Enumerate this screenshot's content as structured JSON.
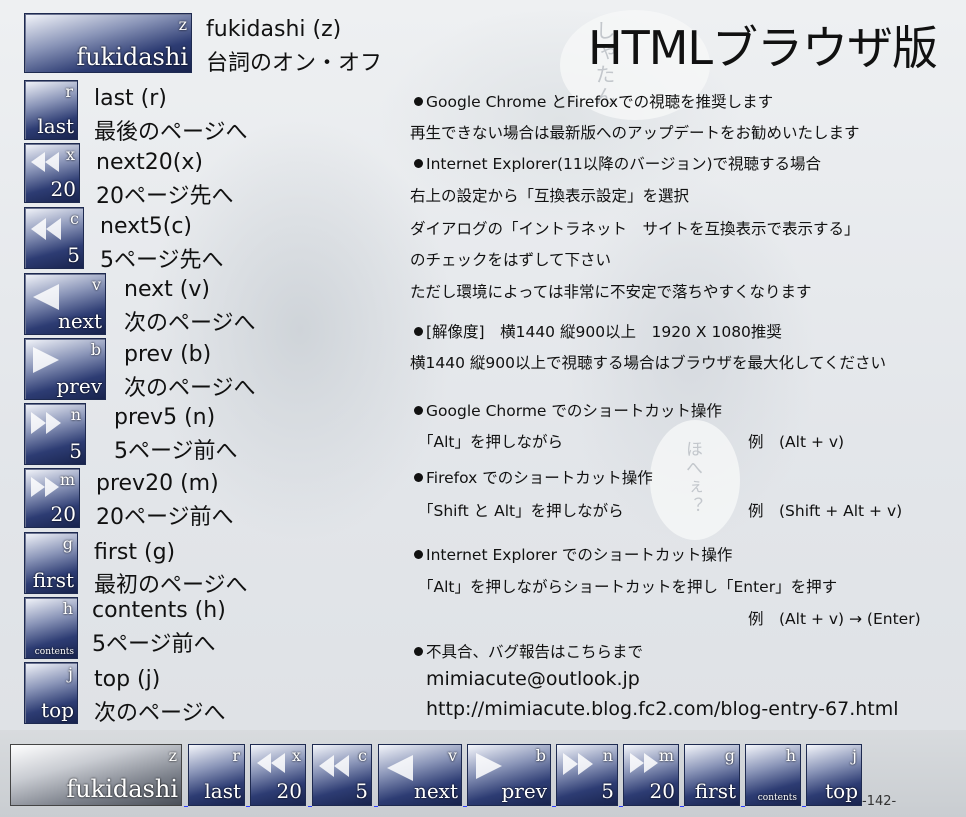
{
  "header": {
    "title": "HTMLブラウザ版"
  },
  "shortcuts": [
    {
      "key": "z",
      "word": "fukidashi",
      "title": "fukidashi (z)",
      "desc": "台詞のオン・オフ"
    },
    {
      "key": "r",
      "word": "last",
      "title": "last (r)",
      "desc": "最後のページへ"
    },
    {
      "key": "x",
      "word": "20",
      "title": "next20(x)",
      "desc": "20ページ先へ"
    },
    {
      "key": "c",
      "word": "5",
      "title": "next5(c)",
      "desc": "5ページ先へ"
    },
    {
      "key": "v",
      "word": "next",
      "title": "next (v)",
      "desc": "次のページへ"
    },
    {
      "key": "b",
      "word": "prev",
      "title": "prev (b)",
      "desc": "次のページへ"
    },
    {
      "key": "n",
      "word": "5",
      "title": "prev5 (n)",
      "desc": "5ページ前へ"
    },
    {
      "key": "m",
      "word": "20",
      "title": "prev20 (m)",
      "desc": "20ページ前へ"
    },
    {
      "key": "g",
      "word": "first",
      "title": "first (g)",
      "desc": "最初のページへ"
    },
    {
      "key": "h",
      "word": "contents",
      "title": "contents (h)",
      "desc": "5ページ前へ"
    },
    {
      "key": "j",
      "word": "top",
      "title": "top (j)",
      "desc": "次のページへ"
    }
  ],
  "info": {
    "l1": "Google Chrome とFirefoxでの視聴を推奨します",
    "l2": "再生できない場合は最新版へのアップデートをお勧めいたします",
    "l3": "Internet Explorer(11以降のバージョン)で視聴する場合",
    "l4": "右上の設定から「互換表示設定」を選択",
    "l5": "ダイアログの「イントラネット　サイトを互換表示で表示する」",
    "l6": "のチェックをはずして下さい",
    "l7": "ただし環境によっては非常に不安定で落ちやすくなります",
    "l8": "[解像度]　横1440 縦900以上　1920 X 1080推奨",
    "l9": "横1440 縦900以上で視聴する場合はブラウザを最大化してください",
    "l10": "Google Chorme でのショートカット操作",
    "l11a": "「Alt」を押しながら",
    "l11b": "例　(Alt + v)",
    "l12": "Firefox でのショートカット操作",
    "l13a": "「Shift と Alt」を押しながら",
    "l13b": "例　(Shift + Alt + v)",
    "l14": "Internet Explorer でのショートカット操作",
    "l15": "「Alt」を押しながらショートカットを押し「Enter」を押す",
    "l16": "例　(Alt + v) → (Enter)",
    "l17": "不具合、バグ報告はこちらまで",
    "email": "mimiacute@outlook.jp",
    "url": "http://mimiacute.blog.fc2.com/blog-entry-67.html"
  },
  "nav": [
    {
      "key": "z",
      "word": "fukidashi"
    },
    {
      "key": "r",
      "word": "last"
    },
    {
      "key": "x",
      "word": "20"
    },
    {
      "key": "c",
      "word": "5"
    },
    {
      "key": "v",
      "word": "next"
    },
    {
      "key": "b",
      "word": "prev"
    },
    {
      "key": "n",
      "word": "5"
    },
    {
      "key": "m",
      "word": "20"
    },
    {
      "key": "g",
      "word": "first"
    },
    {
      "key": "h",
      "word": "contents"
    },
    {
      "key": "j",
      "word": "top"
    }
  ],
  "page_number": "-142-",
  "bg_text": {
    "a": "しゃたん",
    "b": "ほへぇ？"
  }
}
